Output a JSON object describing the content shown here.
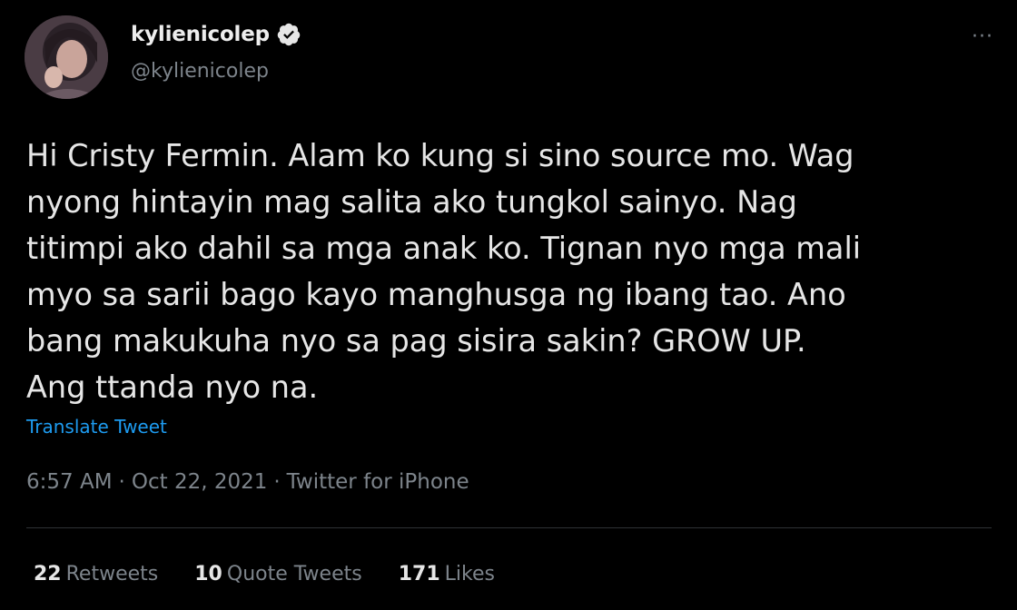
{
  "author": {
    "display_name": "kylienicolep",
    "handle": "@kylienicolep",
    "avatar_icon": "profile-photo",
    "verified_icon": "verified-badge-icon"
  },
  "more_label": "···",
  "tweet": {
    "lines": [
      "Hi Cristy Fermin. Alam ko kung si sino source mo. Wag",
      "nyong hintayin mag salita ako tungkol sainyo. Nag",
      "titimpi ako dahil sa mga anak ko. Tignan nyo mga mali",
      "myo sa sarii bago kayo manghusga ng ibang tao. Ano",
      "bang makukuha nyo sa pag sisira sakin? GROW UP.",
      "Ang ttanda nyo na."
    ],
    "translate_label": "Translate Tweet"
  },
  "meta": {
    "time": "6:57 AM",
    "separator": "·",
    "date": "Oct 22, 2021",
    "source": "Twitter for iPhone"
  },
  "stats": [
    {
      "count": "22",
      "label": "Retweets"
    },
    {
      "count": "10",
      "label": "Quote Tweets"
    },
    {
      "count": "171",
      "label": "Likes"
    }
  ],
  "colors": {
    "background": "#000000",
    "text": "#e6e6e6",
    "secondary": "#7d848b",
    "link": "#1d9bf0",
    "divider": "#2f3336"
  }
}
